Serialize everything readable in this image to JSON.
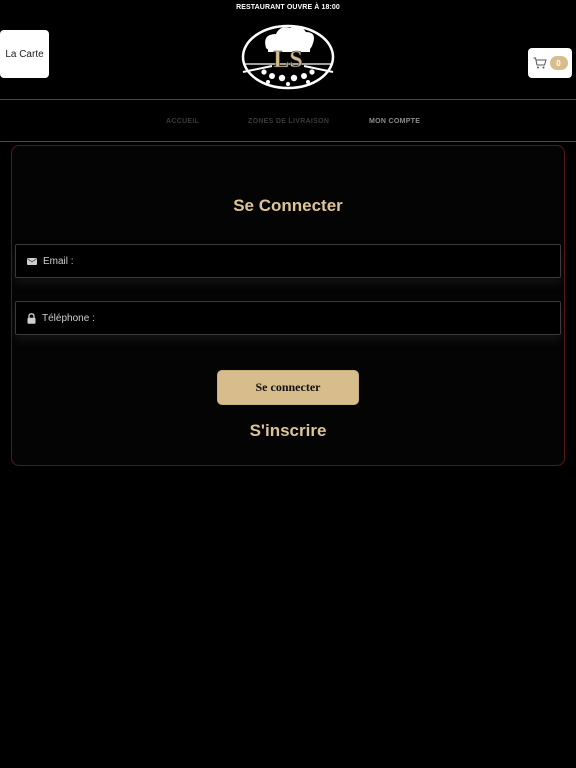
{
  "header": {
    "status_text": "RESTAURANT OUVRE À 18:00",
    "menu_button_label": "La Carte",
    "cart_count": "0",
    "logo_text": "LS"
  },
  "nav": {
    "items": [
      {
        "label": "ACCUEIL",
        "active": false
      },
      {
        "label": "ZONES DE LIVRAISON",
        "active": false
      },
      {
        "label": "MON COMPTE",
        "active": true
      }
    ]
  },
  "login": {
    "title": "Se Connecter",
    "email_placeholder": "Email :",
    "phone_placeholder": "Téléphone :",
    "submit_label": "Se connecter",
    "register_link": "S'inscrire"
  },
  "colors": {
    "accent": "#d8bd8c",
    "title": "#dcc497",
    "card_border": "#5a1616",
    "background": "#000000"
  },
  "icons": [
    "logo-chef-hat",
    "cart-icon",
    "mail-icon",
    "lock-icon"
  ]
}
